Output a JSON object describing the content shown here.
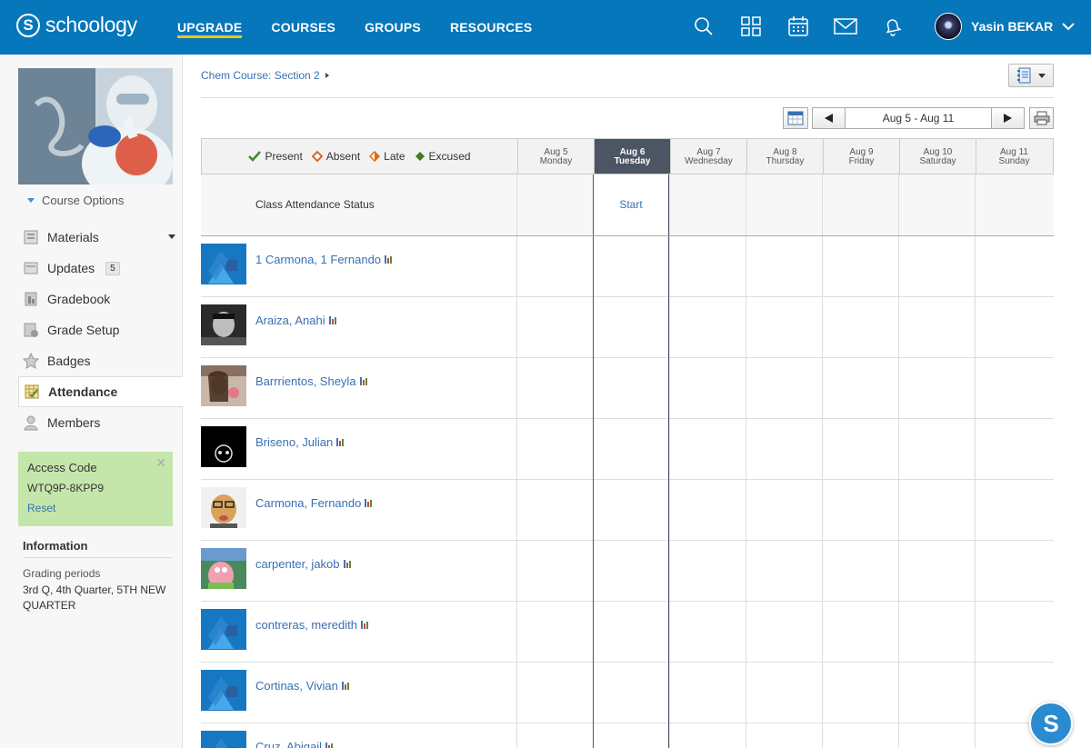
{
  "brand": {
    "logo_letter": "S",
    "name": "schoology"
  },
  "nav": {
    "items": [
      {
        "label": "UPGRADE"
      },
      {
        "label": "COURSES"
      },
      {
        "label": "GROUPS"
      },
      {
        "label": "RESOURCES"
      }
    ],
    "icons": [
      "search-icon",
      "apps-grid-icon",
      "calendar-icon",
      "mail-icon",
      "notifications-icon"
    ]
  },
  "user": {
    "name": "Yasin BEKAR"
  },
  "sidebar": {
    "course_options": "Course Options",
    "menu": [
      {
        "label": "Materials",
        "icon": "materials-icon"
      },
      {
        "label": "Updates",
        "icon": "updates-icon",
        "count": "5"
      },
      {
        "label": "Gradebook",
        "icon": "gradebook-icon"
      },
      {
        "label": "Grade Setup",
        "icon": "grade-setup-icon"
      },
      {
        "label": "Badges",
        "icon": "badges-icon"
      },
      {
        "label": "Attendance",
        "icon": "attendance-icon"
      },
      {
        "label": "Members",
        "icon": "members-icon"
      }
    ],
    "access_code": {
      "title": "Access Code",
      "code": "WTQ9P-8KPP9",
      "reset": "Reset"
    },
    "information": {
      "title": "Information",
      "label": "Grading periods",
      "value": "3rd Q, 4th Quarter, 5TH NEW QUARTER"
    }
  },
  "breadcrumb": {
    "course": "Chem Course: Section 2"
  },
  "week": {
    "range": "Aug 5 - Aug 11"
  },
  "legend": {
    "present": "Present",
    "absent": "Absent",
    "late": "Late",
    "excused": "Excused",
    "colors": {
      "present": "#3d8b2a",
      "absent": "#d35a1c",
      "late": "#e06a12",
      "excused": "#3f7d22"
    }
  },
  "days": [
    {
      "date": "Aug 5",
      "day": "Monday"
    },
    {
      "date": "Aug 6",
      "day": "Tuesday",
      "today": true
    },
    {
      "date": "Aug 7",
      "day": "Wednesday"
    },
    {
      "date": "Aug 8",
      "day": "Thursday"
    },
    {
      "date": "Aug 9",
      "day": "Friday"
    },
    {
      "date": "Aug 10",
      "day": "Saturday"
    },
    {
      "date": "Aug 11",
      "day": "Sunday"
    }
  ],
  "status_row": {
    "label": "Class Attendance Status",
    "start": "Start"
  },
  "students": [
    {
      "name": "1 Carmona, 1 Fernando",
      "avatar": "default"
    },
    {
      "name": "Araiza, Anahi",
      "avatar": "photo-bw"
    },
    {
      "name": "Barrrientos, Sheyla",
      "avatar": "photo-color"
    },
    {
      "name": "Briseno, Julian",
      "avatar": "photo-dark"
    },
    {
      "name": "Carmona, Fernando",
      "avatar": "photo-dog"
    },
    {
      "name": "carpenter, jakob",
      "avatar": "photo-cartoon"
    },
    {
      "name": "contreras, meredith",
      "avatar": "default"
    },
    {
      "name": "Cortinas, Vivian",
      "avatar": "default"
    },
    {
      "name": "Cruz, Abigail",
      "avatar": "default"
    }
  ],
  "help_button": {
    "label": "S"
  },
  "colors": {
    "topbar": "#0677ba",
    "link": "#3a6fb3",
    "today_header": "#4b5563",
    "access_bg": "#c5e6ab"
  }
}
